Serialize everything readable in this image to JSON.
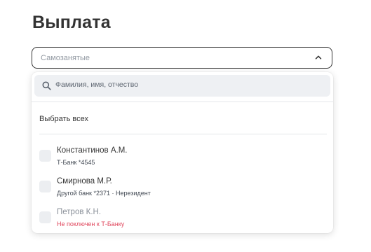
{
  "page": {
    "title": "Выплата"
  },
  "select": {
    "value": "Самозанятые"
  },
  "dropdown": {
    "search": {
      "placeholder": "Фамилия, имя, отчество"
    },
    "select_all_label": "Выбрать всех",
    "items": [
      {
        "name": "Константинов А.М.",
        "details": "Т-Банк *4545",
        "disabled": false
      },
      {
        "name": "Смирнова М.Р.",
        "details": "Другой банк *2371 · Нерезидент",
        "disabled": false
      },
      {
        "name": "Петров К.Н.",
        "details": "Не поключен к Т-Банку",
        "disabled": true
      }
    ]
  },
  "icons": {
    "select": "chevron-up-icon",
    "search": "search-icon"
  },
  "colors": {
    "text": "#333333",
    "muted": "#9299a2",
    "error": "#e0475d",
    "search_bg": "#eef0f3",
    "checkbox_bg": "#eceef1"
  }
}
